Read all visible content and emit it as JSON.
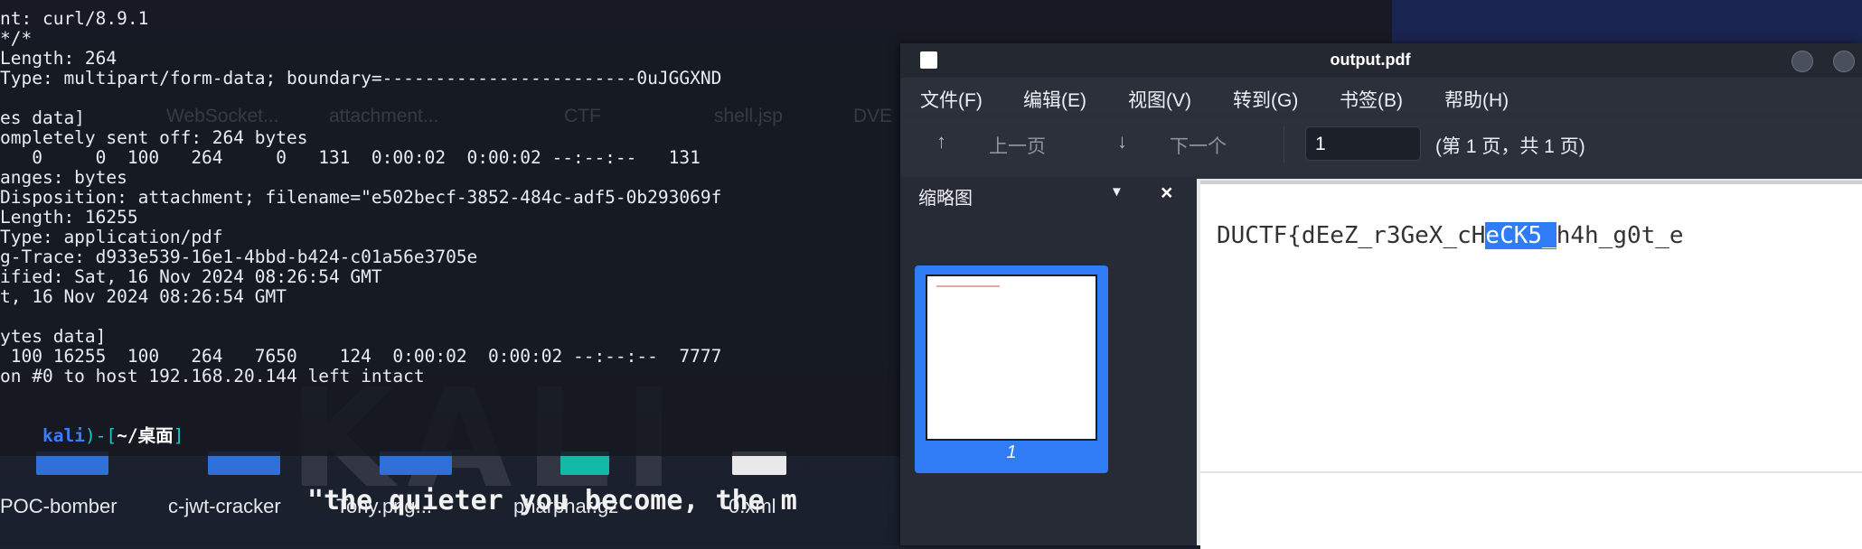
{
  "terminal": {
    "lines": [
      "nt: curl/8.9.1",
      "*/*",
      "Length: 264",
      "Type: multipart/form-data; boundary=------------------------0uJGGXND",
      "",
      "es data]",
      "ompletely sent off: 264 bytes",
      "   0     0  100   264     0   131  0:00:02  0:00:02 --:--:--   131",
      "anges: bytes",
      "Disposition: attachment; filename=\"e502becf-3852-484c-adf5-0b293069f",
      "Length: 16255",
      "Type: application/pdf",
      "g-Trace: d933e539-16e1-4bbd-b424-c01a56e3705e",
      "ified: Sat, 16 Nov 2024 08:26:54 GMT",
      "t, 16 Nov 2024 08:26:54 GMT",
      "",
      "ytes data]",
      " 100 16255  100   264   7650    124  0:00:02  0:00:02 --:--:--  7777",
      "on #0 to host 192.168.20.144 left intact"
    ],
    "prompt": {
      "user": "kali",
      "sep1": ")-[",
      "path": "~/桌面",
      "sep2": "]"
    },
    "ghost_labels": [
      "WebSocket...",
      "attachment...",
      "CTF",
      "shell.jsp",
      "DVE"
    ]
  },
  "desktop": {
    "icons": [
      "POC-bomber",
      "c-jwt-cracker",
      "Tony.png...",
      "pharphar.gz",
      "0.xml"
    ],
    "tagline": "\"the quieter you become, the m"
  },
  "pdf_viewer": {
    "window_title": "output.pdf",
    "menu": [
      "文件(F)",
      "编辑(E)",
      "视图(V)",
      "转到(G)",
      "书签(B)",
      "帮助(H)"
    ],
    "toolbar": {
      "prev_label": "上一页",
      "next_label": "下一个",
      "page_value": "1",
      "page_status": "(第 1 页，共 1 页)"
    },
    "sidebar": {
      "title": "缩略图",
      "thumbnail_label": "1"
    },
    "document": {
      "flag_before": "DUCTF{dEeZ_r3GeX_cH",
      "flag_selected": "eCK5_",
      "flag_after": "h4h_g0t_e"
    }
  },
  "colors": {
    "accent": "#2f7cf6",
    "prompt_user": "#3d7dff",
    "prompt_bracket": "#22c3ce"
  }
}
